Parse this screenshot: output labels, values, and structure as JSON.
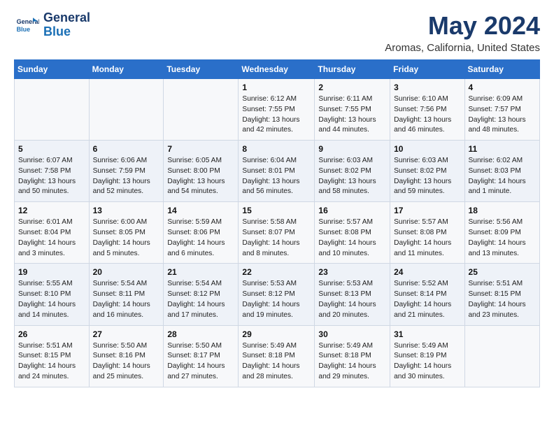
{
  "header": {
    "logo_line1": "General",
    "logo_line2": "Blue",
    "month": "May 2024",
    "location": "Aromas, California, United States"
  },
  "days_of_week": [
    "Sunday",
    "Monday",
    "Tuesday",
    "Wednesday",
    "Thursday",
    "Friday",
    "Saturday"
  ],
  "weeks": [
    [
      {
        "day": "",
        "info": ""
      },
      {
        "day": "",
        "info": ""
      },
      {
        "day": "",
        "info": ""
      },
      {
        "day": "1",
        "info": "Sunrise: 6:12 AM\nSunset: 7:55 PM\nDaylight: 13 hours and 42 minutes."
      },
      {
        "day": "2",
        "info": "Sunrise: 6:11 AM\nSunset: 7:55 PM\nDaylight: 13 hours and 44 minutes."
      },
      {
        "day": "3",
        "info": "Sunrise: 6:10 AM\nSunset: 7:56 PM\nDaylight: 13 hours and 46 minutes."
      },
      {
        "day": "4",
        "info": "Sunrise: 6:09 AM\nSunset: 7:57 PM\nDaylight: 13 hours and 48 minutes."
      }
    ],
    [
      {
        "day": "5",
        "info": "Sunrise: 6:07 AM\nSunset: 7:58 PM\nDaylight: 13 hours and 50 minutes."
      },
      {
        "day": "6",
        "info": "Sunrise: 6:06 AM\nSunset: 7:59 PM\nDaylight: 13 hours and 52 minutes."
      },
      {
        "day": "7",
        "info": "Sunrise: 6:05 AM\nSunset: 8:00 PM\nDaylight: 13 hours and 54 minutes."
      },
      {
        "day": "8",
        "info": "Sunrise: 6:04 AM\nSunset: 8:01 PM\nDaylight: 13 hours and 56 minutes."
      },
      {
        "day": "9",
        "info": "Sunrise: 6:03 AM\nSunset: 8:02 PM\nDaylight: 13 hours and 58 minutes."
      },
      {
        "day": "10",
        "info": "Sunrise: 6:03 AM\nSunset: 8:02 PM\nDaylight: 13 hours and 59 minutes."
      },
      {
        "day": "11",
        "info": "Sunrise: 6:02 AM\nSunset: 8:03 PM\nDaylight: 14 hours and 1 minute."
      }
    ],
    [
      {
        "day": "12",
        "info": "Sunrise: 6:01 AM\nSunset: 8:04 PM\nDaylight: 14 hours and 3 minutes."
      },
      {
        "day": "13",
        "info": "Sunrise: 6:00 AM\nSunset: 8:05 PM\nDaylight: 14 hours and 5 minutes."
      },
      {
        "day": "14",
        "info": "Sunrise: 5:59 AM\nSunset: 8:06 PM\nDaylight: 14 hours and 6 minutes."
      },
      {
        "day": "15",
        "info": "Sunrise: 5:58 AM\nSunset: 8:07 PM\nDaylight: 14 hours and 8 minutes."
      },
      {
        "day": "16",
        "info": "Sunrise: 5:57 AM\nSunset: 8:08 PM\nDaylight: 14 hours and 10 minutes."
      },
      {
        "day": "17",
        "info": "Sunrise: 5:57 AM\nSunset: 8:08 PM\nDaylight: 14 hours and 11 minutes."
      },
      {
        "day": "18",
        "info": "Sunrise: 5:56 AM\nSunset: 8:09 PM\nDaylight: 14 hours and 13 minutes."
      }
    ],
    [
      {
        "day": "19",
        "info": "Sunrise: 5:55 AM\nSunset: 8:10 PM\nDaylight: 14 hours and 14 minutes."
      },
      {
        "day": "20",
        "info": "Sunrise: 5:54 AM\nSunset: 8:11 PM\nDaylight: 14 hours and 16 minutes."
      },
      {
        "day": "21",
        "info": "Sunrise: 5:54 AM\nSunset: 8:12 PM\nDaylight: 14 hours and 17 minutes."
      },
      {
        "day": "22",
        "info": "Sunrise: 5:53 AM\nSunset: 8:12 PM\nDaylight: 14 hours and 19 minutes."
      },
      {
        "day": "23",
        "info": "Sunrise: 5:53 AM\nSunset: 8:13 PM\nDaylight: 14 hours and 20 minutes."
      },
      {
        "day": "24",
        "info": "Sunrise: 5:52 AM\nSunset: 8:14 PM\nDaylight: 14 hours and 21 minutes."
      },
      {
        "day": "25",
        "info": "Sunrise: 5:51 AM\nSunset: 8:15 PM\nDaylight: 14 hours and 23 minutes."
      }
    ],
    [
      {
        "day": "26",
        "info": "Sunrise: 5:51 AM\nSunset: 8:15 PM\nDaylight: 14 hours and 24 minutes."
      },
      {
        "day": "27",
        "info": "Sunrise: 5:50 AM\nSunset: 8:16 PM\nDaylight: 14 hours and 25 minutes."
      },
      {
        "day": "28",
        "info": "Sunrise: 5:50 AM\nSunset: 8:17 PM\nDaylight: 14 hours and 27 minutes."
      },
      {
        "day": "29",
        "info": "Sunrise: 5:49 AM\nSunset: 8:18 PM\nDaylight: 14 hours and 28 minutes."
      },
      {
        "day": "30",
        "info": "Sunrise: 5:49 AM\nSunset: 8:18 PM\nDaylight: 14 hours and 29 minutes."
      },
      {
        "day": "31",
        "info": "Sunrise: 5:49 AM\nSunset: 8:19 PM\nDaylight: 14 hours and 30 minutes."
      },
      {
        "day": "",
        "info": ""
      }
    ]
  ]
}
